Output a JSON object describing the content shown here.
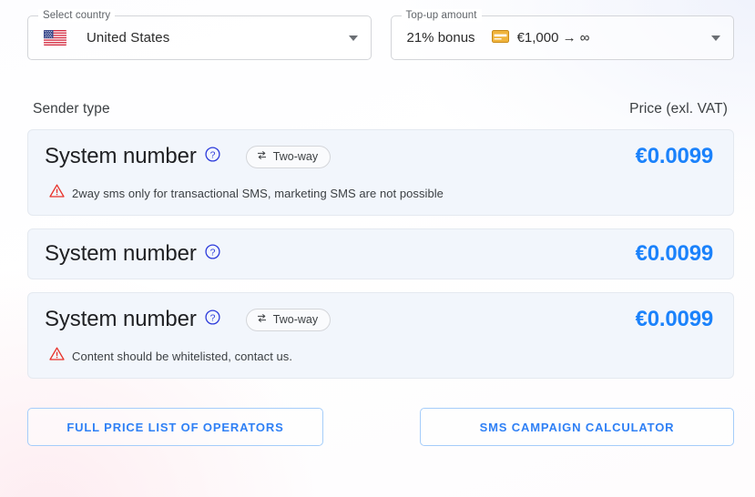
{
  "selectors": [
    {
      "legend": "Select country",
      "icon": "us-flag-icon",
      "value": "United States",
      "name": "country-select"
    },
    {
      "legend": "Top-up amount",
      "bonus": "21% bonus",
      "icon": "credit-card-icon",
      "range": "€1,000 → ∞",
      "name": "topup-amount-select"
    }
  ],
  "table": {
    "header": {
      "sender_type": "Sender type",
      "price": "Price (exl. VAT)"
    },
    "rows": [
      {
        "title": "System number",
        "help": "help-icon",
        "chip": "Two-way",
        "note": "2way sms only for transactional SMS, marketing SMS are not possible",
        "price": "€0.0099"
      },
      {
        "title": "System number",
        "help": "help-icon",
        "chip": null,
        "note": null,
        "price": "€0.0099"
      },
      {
        "title": "System number",
        "help": "help-icon",
        "chip": "Two-way",
        "note": "Content should be whitelisted, contact us.",
        "price": "€0.0099"
      }
    ]
  },
  "actions": {
    "price_list": "Full price list of operators",
    "calculator": "SMS campaign calculator"
  },
  "colors": {
    "price_blue": "#1b82fb",
    "button_blue": "#2f80f5",
    "button_border": "#a5cdfa",
    "card_bg": "#f2f6fc",
    "warning_red": "#e8322a",
    "card_gold": "#e8a33d"
  }
}
